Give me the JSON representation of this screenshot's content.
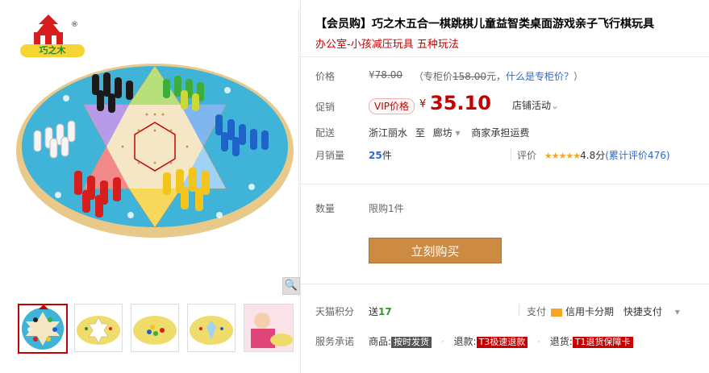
{
  "gallery": {
    "logo_text": "巧之木",
    "logo_mark": "®",
    "zoom_icon": "magnifier-icon",
    "thumbnails": [
      {
        "name": "thumb-1",
        "selected": true
      },
      {
        "name": "thumb-2",
        "selected": false
      },
      {
        "name": "thumb-3",
        "selected": false
      },
      {
        "name": "thumb-4",
        "selected": false
      },
      {
        "name": "thumb-5",
        "selected": false
      }
    ]
  },
  "product": {
    "title": "【会员购】巧之木五合一棋跳棋儿童益智类桌面游戏亲子飞行棋玩具",
    "subtitle": "办公室-小孩减压玩具 五种玩法"
  },
  "price": {
    "label": "价格",
    "currency": "¥",
    "old_price": "78.00",
    "counter_prefix": "（专柜价",
    "counter_price": "158.00",
    "counter_suffix": "元，",
    "counter_link": "什么是专柜价？",
    "counter_close": "）"
  },
  "promo": {
    "label": "促销",
    "vip_badge": "VIP价格",
    "currency": "¥",
    "price": "35.10",
    "store_activity": "店铺活动",
    "store_activity_caret": "⌄"
  },
  "delivery": {
    "label": "配送",
    "from": "浙江丽水",
    "to_word": "至",
    "to": "廊坊",
    "caret": "▾",
    "fee": "商家承担运费"
  },
  "sales": {
    "label": "月销量",
    "count": "25",
    "unit": "件",
    "rating_label": "评价",
    "stars": "★★★★★",
    "score": "4.8分",
    "link": "(累计评价476)"
  },
  "quantity": {
    "label": "数量",
    "limit": "限购1件"
  },
  "buy_button": "立刻购买",
  "points": {
    "label": "天猫积分",
    "prefix": "送",
    "value": "17"
  },
  "payment": {
    "label": "支付",
    "credit": "信用卡分期",
    "quick": "快捷支付",
    "caret": "▾"
  },
  "service": {
    "label": "服务承诺",
    "goods_label": "商品:",
    "goods_tag": "按时发货",
    "refund_label": "退款:",
    "refund_tag": "T3极速退款",
    "return_label": "退货:",
    "return_tag": "T1退货保障卡",
    "sep": "·"
  },
  "colors": {
    "accent": "#c40000",
    "buy_button": "#cd8a42",
    "link": "#3366cc",
    "green": "#339933"
  }
}
